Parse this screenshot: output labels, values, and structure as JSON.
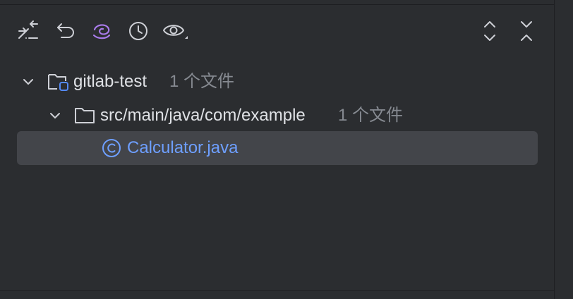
{
  "toolbar": {
    "buttons": [
      {
        "name": "expand-collapse-diff-icon"
      },
      {
        "name": "rollback-icon"
      },
      {
        "name": "ai-swirl-icon"
      },
      {
        "name": "history-icon"
      },
      {
        "name": "preview-eye-icon"
      },
      {
        "name": "expand-all-icon"
      },
      {
        "name": "collapse-all-icon"
      }
    ]
  },
  "tree": {
    "root": {
      "label": "gitlab-test",
      "count": "1 个文件"
    },
    "folder": {
      "label": "src/main/java/com/example",
      "count": "1 个文件"
    },
    "file": {
      "label": "Calculator.java",
      "icon": "java-class-icon"
    }
  },
  "colors": {
    "background": "#2B2D30",
    "selection": "#43454A",
    "accent_blue": "#6E9FFF",
    "muted_text": "#868A91",
    "ai_purple": "#A97BEA"
  }
}
